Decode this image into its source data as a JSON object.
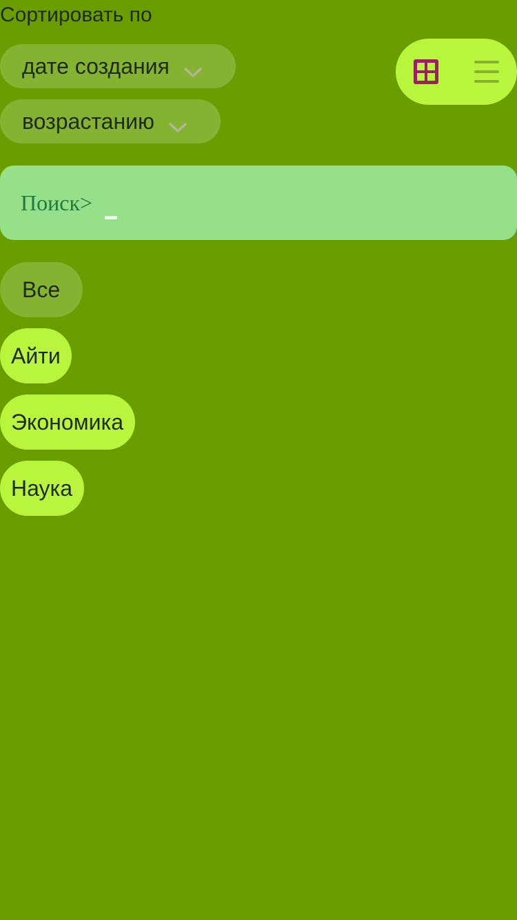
{
  "sort": {
    "title": "Сортировать по",
    "field": {
      "label": "дате создания",
      "icon": "chevron-down-icon"
    },
    "order": {
      "label": "возрастанию",
      "icon": "chevron-down-icon"
    }
  },
  "view_toggle": {
    "grid_icon": "grid-icon",
    "list_icon": "list-icon",
    "active": "grid"
  },
  "search": {
    "label": "Поиск> "
  },
  "categories": [
    {
      "label": "Все",
      "selected": true
    },
    {
      "label": "Айти",
      "selected": false
    },
    {
      "label": "Экономика",
      "selected": false
    },
    {
      "label": "Наука",
      "selected": false
    }
  ],
  "colors": {
    "background": "#6a9e00",
    "chip_active": "#b8f53c",
    "chip_muted": "#84b231",
    "search_bg": "#96e08a",
    "search_text": "#1f7a3f",
    "grid_icon": "#9b1f63",
    "list_icon": "#84b231",
    "chevron": "#b5b59a"
  }
}
